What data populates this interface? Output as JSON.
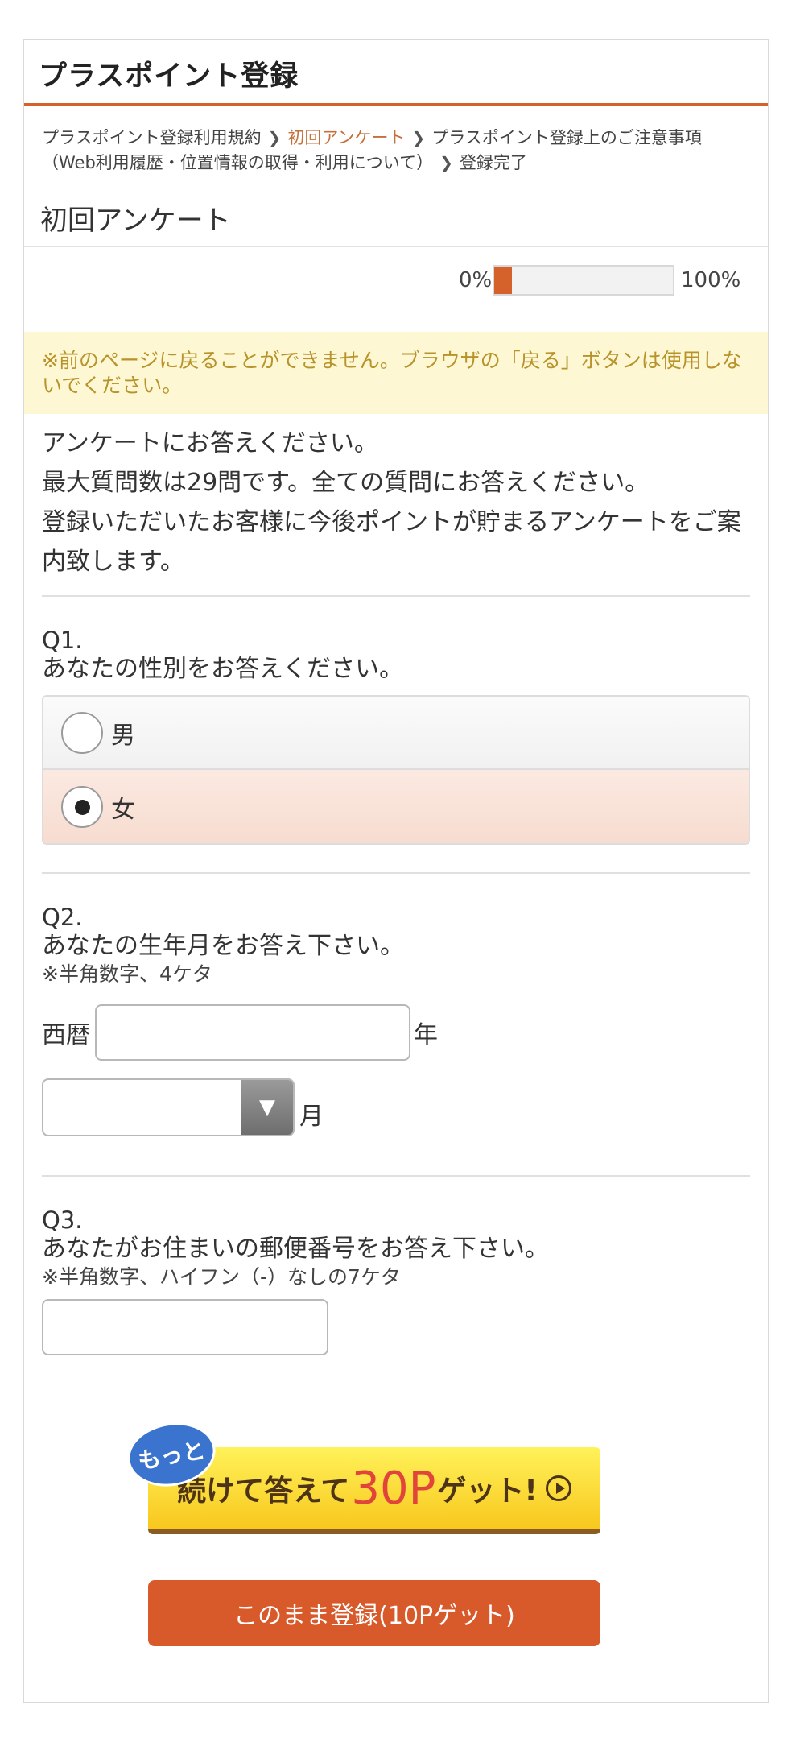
{
  "header": {
    "title": "プラスポイント登録"
  },
  "breadcrumb": {
    "step1": "プラスポイント登録利用規約",
    "step2": "初回アンケート",
    "step3": "プラスポイント登録上のご注意事項",
    "step3b": "（Web利用履歴・位置情報の取得・利用について）",
    "step4": "登録完了",
    "separator": ">"
  },
  "section": {
    "title": "初回アンケート"
  },
  "progress": {
    "start_label": "0%",
    "end_label": "100%",
    "value_fraction": 0.1
  },
  "notice": {
    "text": "※前のページに戻ることができません。ブラウザの「戻る」ボタンは使用しないでください。"
  },
  "intro": {
    "line1": "アンケートにお答えください。",
    "line2": "最大質問数は29問です。全ての質問にお答えください。",
    "line3": "登録いただいたお客様に今後ポイントが貯まるアンケートをご案内致します。"
  },
  "q1": {
    "number": "Q1.",
    "text": "あなたの性別をお答えください。",
    "options": [
      {
        "label": "男",
        "selected": false
      },
      {
        "label": "女",
        "selected": true
      }
    ]
  },
  "q2": {
    "number": "Q2.",
    "text": "あなたの生年月をお答え下さい。",
    "note": "※半角数字、4ケタ",
    "year_prefix": "西暦",
    "year_suffix": "年",
    "year_value": "",
    "month_value": "",
    "month_suffix": "月"
  },
  "q3": {
    "number": "Q3.",
    "text": "あなたがお住まいの郵便番号をお答え下さい。",
    "note": "※半角数字、ハイフン（-）なしの7ケタ",
    "zip_value": ""
  },
  "promo": {
    "bubble": "もっと",
    "text_before": "続けて答えて",
    "points": "30P",
    "text_after": "ゲット!",
    "icon": "play-circle-icon"
  },
  "submit": {
    "label": "このまま登録(10Pゲット)"
  },
  "colors": {
    "accent": "#d4622a",
    "notice_bg": "#fdf8d3",
    "notice_text": "#b8922b",
    "selected_bg": "#f7dcd0"
  }
}
